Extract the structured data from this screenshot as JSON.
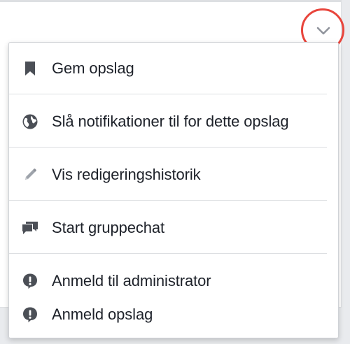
{
  "menu": {
    "items": [
      {
        "label": "Gem opslag",
        "icon": "bookmark-icon"
      },
      {
        "label": "Slå notifikationer til for dette opslag",
        "icon": "globe-notification-icon"
      },
      {
        "label": "Vis redigeringshistorik",
        "icon": "pencil-icon"
      },
      {
        "label": "Start gruppechat",
        "icon": "chat-bubbles-icon"
      },
      {
        "label": "Anmeld til administrator",
        "icon": "report-icon"
      },
      {
        "label": "Anmeld opslag",
        "icon": "report-icon"
      }
    ]
  },
  "colors": {
    "highlight_circle": "#e8453c",
    "icon": "#616770",
    "text": "#1d2129",
    "divider": "#dddfe2"
  },
  "chevron_icon": "chevron-down-icon"
}
